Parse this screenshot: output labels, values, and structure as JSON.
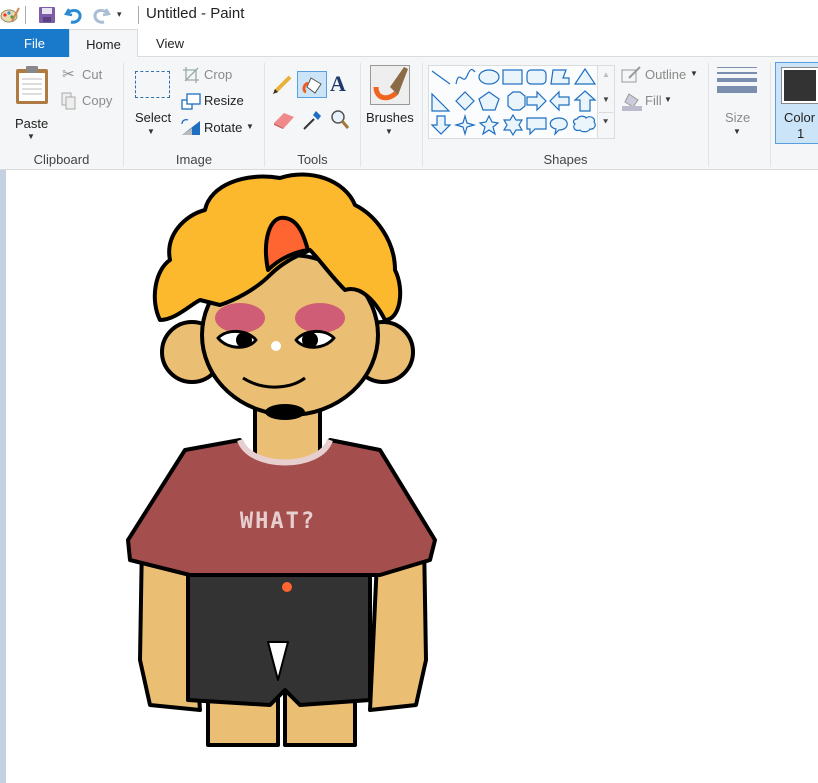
{
  "window": {
    "title": "Untitled - Paint"
  },
  "quick_access": [
    "paint-menu-icon",
    "save-icon",
    "undo-icon",
    "redo-icon",
    "customize-dropdown-icon"
  ],
  "tabs": [
    {
      "label": "File"
    },
    {
      "label": "Home",
      "selected": true
    },
    {
      "label": "View"
    }
  ],
  "ribbon": {
    "clipboard": {
      "label": "Clipboard",
      "paste": "Paste",
      "cut": "Cut",
      "copy": "Copy"
    },
    "image": {
      "label": "Image",
      "select": "Select",
      "crop": "Crop",
      "resize": "Resize",
      "rotate": "Rotate"
    },
    "tools": {
      "label": "Tools",
      "active": "fill"
    },
    "brushes": {
      "label": "Brushes"
    },
    "shapes": {
      "label": "Shapes",
      "outline": "Outline",
      "fill": "Fill"
    },
    "size": {
      "label": "Size"
    },
    "color1": {
      "label": "Color",
      "label2": "1",
      "value": "#333333"
    }
  },
  "canvas": {
    "shirt_text": "WHAT?"
  },
  "colors": {
    "accent": "#1979ca",
    "hair": "#fdb92e",
    "hair_streak": "#fe6530",
    "skin": "#eabf73",
    "blush": "#d25a55",
    "shirt": "#a44f4e",
    "trim": "#e8cfcf",
    "shorts": "#333333"
  }
}
